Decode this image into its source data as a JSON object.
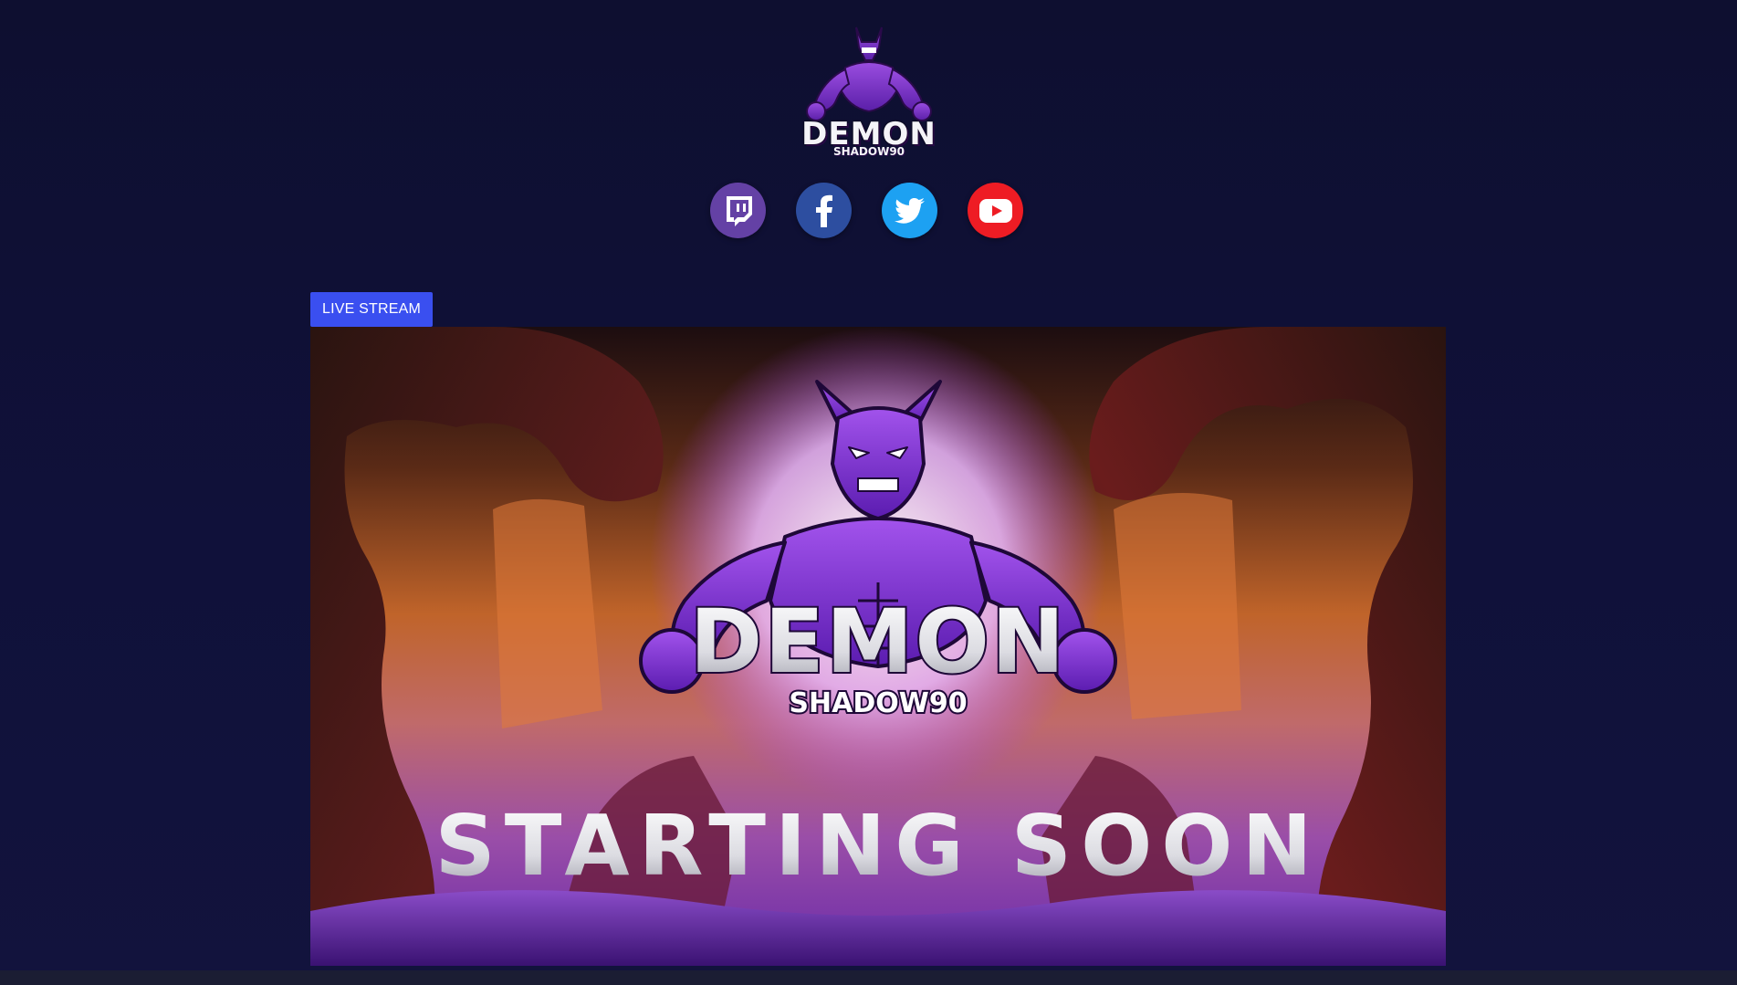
{
  "header": {
    "logo": {
      "icon": "demon-mascot-logo",
      "title": "DEMON",
      "subtitle": "SHADOW90"
    },
    "socials": [
      {
        "name": "twitch",
        "icon": "twitch-icon",
        "color": "#6441a5"
      },
      {
        "name": "facebook",
        "icon": "facebook-icon",
        "color": "#2d4ea0"
      },
      {
        "name": "twitter",
        "icon": "twitter-icon",
        "color": "#1da1f2"
      },
      {
        "name": "youtube",
        "icon": "youtube-icon",
        "color": "#ee1c24"
      }
    ]
  },
  "stream": {
    "badge_label": "LIVE STREAM",
    "badge_color": "#3a4ff0",
    "screen": {
      "logo_title": "DEMON",
      "logo_subtitle": "SHADOW90",
      "status_text": "STARTING SOON"
    }
  },
  "colors": {
    "page_background": "#0f1030",
    "accent_purple": "#8a2be2",
    "bottom_strip": "#1b1d33"
  }
}
